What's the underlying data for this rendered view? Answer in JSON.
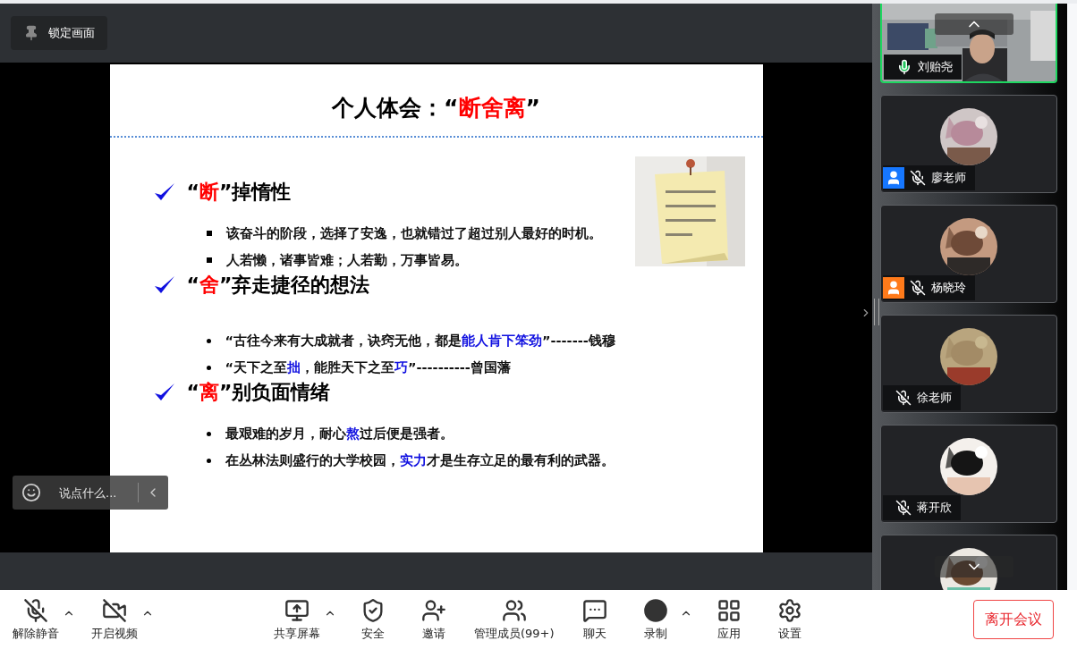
{
  "lock_button": {
    "label": "锁定画面"
  },
  "slide": {
    "title": [
      {
        "text": "个人体会：“",
        "emphasis": false
      },
      {
        "text": "断舍离",
        "emphasis": true
      },
      {
        "text": "”",
        "emphasis": false
      }
    ],
    "sections": [
      {
        "heading": [
          {
            "text": "“",
            "emphasis": false
          },
          {
            "text": "断",
            "emphasis": true
          },
          {
            "text": "”掉惰性",
            "emphasis": false
          }
        ],
        "kind": "square",
        "items": [
          {
            "parts": [
              {
                "text": "该奋斗的阶段，选择了安逸，也就错过了超过别人最好的时机。",
                "emphasis": false
              }
            ]
          },
          {
            "parts": [
              {
                "text": "人若懒，诸事皆难；人若勤，万事皆易。",
                "emphasis": false
              }
            ]
          }
        ]
      },
      {
        "heading": [
          {
            "text": "“",
            "emphasis": false
          },
          {
            "text": "舍",
            "emphasis": true
          },
          {
            "text": "”弃走捷径的想法",
            "emphasis": false
          }
        ],
        "kind": "dot",
        "items": [
          {
            "parts": [
              {
                "text": "“古往今来有大成就者，诀窍无他，都是",
                "emphasis": false
              },
              {
                "text": "能人肯下笨劲",
                "emphasis": true
              },
              {
                "text": "”-------钱穆",
                "emphasis": false
              }
            ]
          },
          {
            "parts": [
              {
                "text": "“天下之至",
                "emphasis": false
              },
              {
                "text": "拙",
                "emphasis": true
              },
              {
                "text": "，能胜天下之至",
                "emphasis": false
              },
              {
                "text": "巧",
                "emphasis": true
              },
              {
                "text": "”----------曾国藩",
                "emphasis": false
              }
            ]
          }
        ]
      },
      {
        "heading": [
          {
            "text": "“",
            "emphasis": false
          },
          {
            "text": "离",
            "emphasis": true
          },
          {
            "text": "”别负面情绪",
            "emphasis": false
          }
        ],
        "kind": "dot",
        "items": [
          {
            "parts": [
              {
                "text": "最艰难的岁月，耐心",
                "emphasis": false
              },
              {
                "text": "熬",
                "emphasis": true
              },
              {
                "text": "过后便是强者。",
                "emphasis": false
              }
            ]
          },
          {
            "parts": [
              {
                "text": "在丛林法则盛行的大学校园，",
                "emphasis": false
              },
              {
                "text": "实力",
                "emphasis": true
              },
              {
                "text": "才是生存立足的最有利的武器。",
                "emphasis": false
              }
            ]
          }
        ]
      }
    ]
  },
  "chat": {
    "placeholder": "说点什么..."
  },
  "participants": [
    {
      "name": "刘贻尧",
      "kind": "video",
      "muted": false,
      "speaking": true
    },
    {
      "name": "廖老师",
      "kind": "avatar",
      "muted": true,
      "speaking": false,
      "color": "#1677ff"
    },
    {
      "name": "杨晓玲",
      "kind": "avatar",
      "muted": true,
      "speaking": false,
      "color": "#ff7a1a"
    },
    {
      "name": "徐老师",
      "kind": "avatar",
      "muted": true,
      "speaking": false
    },
    {
      "name": "蒋开欣",
      "kind": "avatar",
      "muted": true,
      "speaking": false
    },
    {
      "kind": "avatar",
      "speaking": false
    }
  ],
  "toolbar": {
    "left": [
      {
        "label": "解除静音",
        "kind": "mic",
        "off": true,
        "caret": true
      },
      {
        "label": "开启视频",
        "kind": "video",
        "off": true,
        "caret": true
      }
    ],
    "center": [
      {
        "label": "共享屏幕",
        "kind": "share",
        "caret": true
      },
      {
        "label": "安全",
        "kind": "security",
        "caret": false
      },
      {
        "label": "邀请",
        "kind": "invite",
        "caret": false
      },
      {
        "label": "管理成员(99+)",
        "kind": "members",
        "caret": false
      },
      {
        "label": "聊天",
        "kind": "chat",
        "caret": false
      },
      {
        "label": "录制",
        "kind": "record",
        "caret": true
      },
      {
        "label": "应用",
        "kind": "apps",
        "caret": false
      },
      {
        "label": "设置",
        "kind": "settings",
        "caret": false
      }
    ],
    "leave_button": {
      "label": "离开会议"
    }
  }
}
